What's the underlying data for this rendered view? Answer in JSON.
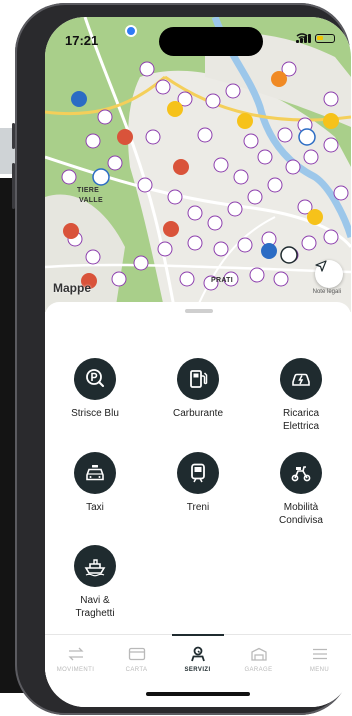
{
  "status_bar": {
    "time": "17:21"
  },
  "map": {
    "attribution": "Mappe",
    "legal": "Note legali",
    "labels": {
      "town_1": "TIERE",
      "town_2": "VALLE",
      "town_3": "PRATI"
    },
    "colors": {
      "land": "#a9cf8a",
      "urban": "#ecebe6",
      "water": "#9cc7ea",
      "road": "#ffffff",
      "highway": "#f4cf5a"
    }
  },
  "services": {
    "items": [
      {
        "label_line1": "Strisce Blu",
        "label_line2": "",
        "icon": "parking-search-icon"
      },
      {
        "label_line1": "Carburante",
        "label_line2": "",
        "icon": "fuel-pump-icon"
      },
      {
        "label_line1": "Ricarica",
        "label_line2": "Elettrica",
        "icon": "ev-charging-icon"
      },
      {
        "label_line1": "Taxi",
        "label_line2": "",
        "icon": "taxi-icon"
      },
      {
        "label_line1": "Treni",
        "label_line2": "",
        "icon": "train-icon"
      },
      {
        "label_line1": "Mobilità",
        "label_line2": "Condivisa",
        "icon": "scooter-icon"
      },
      {
        "label_line1": "Navi &",
        "label_line2": "Traghetti",
        "icon": "ferry-icon"
      }
    ]
  },
  "tabbar": {
    "tabs": [
      {
        "label": "MOVIMENTI",
        "icon": "transfer-icon",
        "active": false
      },
      {
        "label": "CARTA",
        "icon": "card-icon",
        "active": false
      },
      {
        "label": "SERVIZI",
        "icon": "services-icon",
        "active": true
      },
      {
        "label": "GARAGE",
        "icon": "garage-icon",
        "active": false
      },
      {
        "label": "MENU",
        "icon": "menu-icon",
        "active": false
      }
    ]
  },
  "colors": {
    "accent": "#1f2b2f",
    "inactive": "#b9b9b9"
  }
}
